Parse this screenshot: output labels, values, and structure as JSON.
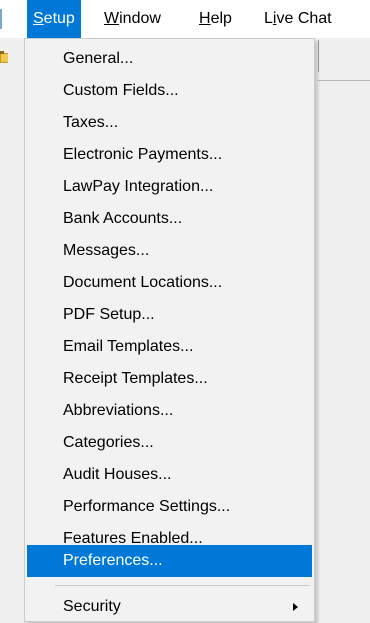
{
  "menubar": {
    "items": [
      {
        "pre": "",
        "acc": "S",
        "post": "etup",
        "active": true
      },
      {
        "pre": "",
        "acc": "W",
        "post": "indow",
        "active": false
      },
      {
        "pre": "",
        "acc": "H",
        "post": "elp",
        "active": false
      },
      {
        "pre": "L",
        "acc": "i",
        "post": "ve Chat",
        "active": false
      }
    ]
  },
  "setup_menu": {
    "items": [
      "General...",
      "Custom Fields...",
      "Taxes...",
      "Electronic Payments...",
      "LawPay Integration...",
      "Bank Accounts...",
      "Messages...",
      "Document Locations...",
      "PDF Setup...",
      "Email Templates...",
      "Receipt Templates...",
      "Abbreviations...",
      "Categories...",
      "Audit Houses...",
      "Performance Settings...",
      "Features Enabled...",
      "Preferences..."
    ],
    "highlighted_label": "Preferences...",
    "submenu_item": "Security",
    "highlight_color": "#0078d7"
  }
}
